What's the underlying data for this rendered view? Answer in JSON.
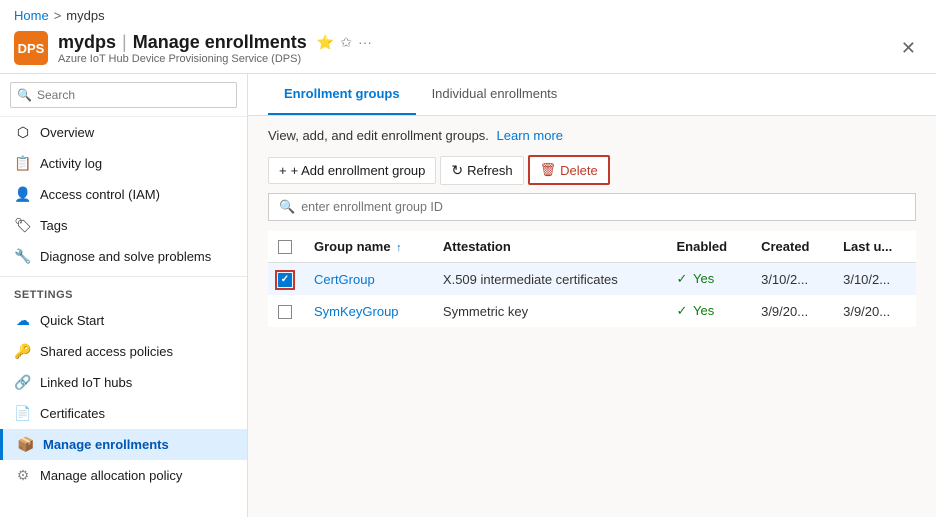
{
  "breadcrumb": {
    "home": "Home",
    "separator": ">",
    "current": "mydps"
  },
  "header": {
    "title": "mydps",
    "pipe": "|",
    "page_title": "Manage enrollments",
    "subtitle": "Azure IoT Hub Device Provisioning Service (DPS)",
    "icon_label": "DPS",
    "icons": [
      "⭐",
      "✩",
      "···"
    ],
    "close": "✕"
  },
  "sidebar": {
    "search_placeholder": "Search",
    "items": [
      {
        "id": "overview",
        "icon": "⬡",
        "label": "Overview"
      },
      {
        "id": "activity-log",
        "icon": "📋",
        "label": "Activity log"
      },
      {
        "id": "access-control",
        "icon": "👤",
        "label": "Access control (IAM)"
      },
      {
        "id": "tags",
        "icon": "🏷",
        "label": "Tags"
      },
      {
        "id": "diagnose",
        "icon": "🔧",
        "label": "Diagnose and solve problems"
      }
    ],
    "settings_label": "Settings",
    "settings_items": [
      {
        "id": "quick-start",
        "icon": "☁",
        "label": "Quick Start"
      },
      {
        "id": "shared-access",
        "icon": "🔑",
        "label": "Shared access policies"
      },
      {
        "id": "linked-iot",
        "icon": "🔗",
        "label": "Linked IoT hubs"
      },
      {
        "id": "certificates",
        "icon": "📄",
        "label": "Certificates"
      },
      {
        "id": "manage-enrollments",
        "icon": "📦",
        "label": "Manage enrollments",
        "active": true
      },
      {
        "id": "manage-allocation",
        "icon": "⚙",
        "label": "Manage allocation policy"
      }
    ]
  },
  "tabs": [
    {
      "id": "enrollment-groups",
      "label": "Enrollment groups",
      "active": true
    },
    {
      "id": "individual-enrollments",
      "label": "Individual enrollments",
      "active": false
    }
  ],
  "description": {
    "text": "View, add, and edit enrollment groups.",
    "link_text": "Learn more"
  },
  "toolbar": {
    "add_label": "+ Add enrollment group",
    "refresh_label": "Refresh",
    "delete_label": "Delete",
    "refresh_icon": "↻",
    "delete_icon": "🗑"
  },
  "search": {
    "placeholder": "enter enrollment group ID"
  },
  "table": {
    "columns": [
      {
        "id": "checkbox",
        "label": ""
      },
      {
        "id": "group-name",
        "label": "Group name",
        "sort": "↑"
      },
      {
        "id": "attestation",
        "label": "Attestation"
      },
      {
        "id": "enabled",
        "label": "Enabled"
      },
      {
        "id": "created",
        "label": "Created"
      },
      {
        "id": "last-updated",
        "label": "Last u..."
      }
    ],
    "rows": [
      {
        "id": "certgroup",
        "checked": true,
        "group_name": "CertGroup",
        "attestation": "X.509 intermediate certificates",
        "enabled": "Yes",
        "created": "3/10/2...",
        "last_updated": "3/10/2...",
        "selected": true
      },
      {
        "id": "symkeygroup",
        "checked": false,
        "group_name": "SymKeyGroup",
        "attestation": "Symmetric key",
        "enabled": "Yes",
        "created": "3/9/20...",
        "last_updated": "3/9/20...",
        "selected": false
      }
    ]
  }
}
